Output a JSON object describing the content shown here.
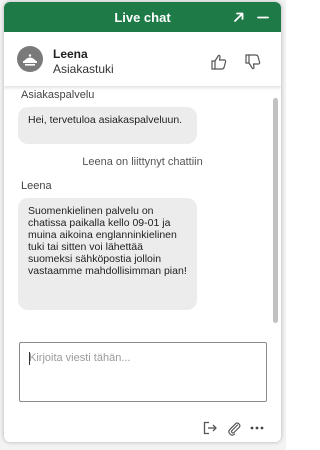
{
  "header": {
    "title": "Live chat",
    "expand_icon": "expand-arrow-icon",
    "minimize_icon": "minimize-icon"
  },
  "agent": {
    "name": "Leena",
    "role": "Asiakastuki",
    "avatar_icon": "person-avatar-icon",
    "thumbs_up_icon": "thumbs-up-icon",
    "thumbs_down_icon": "thumbs-down-icon"
  },
  "messages": [
    {
      "sender": "Asiakaspalvelu",
      "text": "Hei, tervetuloa asiakaspalveluun."
    },
    {
      "system": "Leena on liittynyt chattiin"
    },
    {
      "sender": "Leena",
      "text": "Suomenkielinen palvelu on chatissa paikalla kello 09-01 ja muina aikoina englanninkielinen tuki tai sitten voi lähettää suomeksi sähköpostia jolloin vastaamme mahdollisimman pian!"
    }
  ],
  "input": {
    "placeholder": "Kirjoita viesti tähän...",
    "value": ""
  },
  "footer": {
    "end_chat_icon": "end-chat-icon",
    "attach_icon": "paperclip-icon",
    "more_icon": "more-options-icon"
  },
  "colors": {
    "header_bg": "#1e7a47",
    "bubble_bg": "#ececec",
    "avatar_bg": "#7a7a7a"
  }
}
